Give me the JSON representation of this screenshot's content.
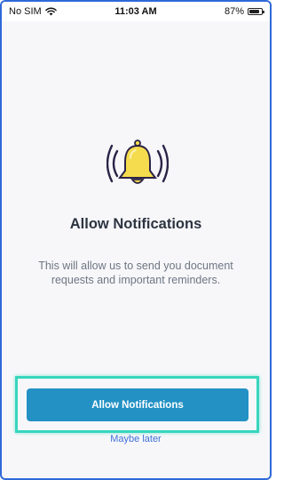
{
  "status_bar": {
    "carrier": "No SIM",
    "time": "11:03 AM",
    "battery_percent": "87%",
    "battery_level": 0.87,
    "wifi_icon": "wifi-icon",
    "battery_icon": "battery-icon"
  },
  "main": {
    "icon": "bell-ringing-icon",
    "title": "Allow Notifications",
    "description": "This will allow us to send you document requests and important reminders."
  },
  "actions": {
    "primary_label": "Allow Notifications",
    "secondary_label": "Maybe later"
  },
  "colors": {
    "primary_button": "#2391c4",
    "highlight_outline": "#37d6bd",
    "link": "#3f6fd8",
    "bell_fill": "#f5dc4e",
    "frame_border": "#2f69d8"
  }
}
